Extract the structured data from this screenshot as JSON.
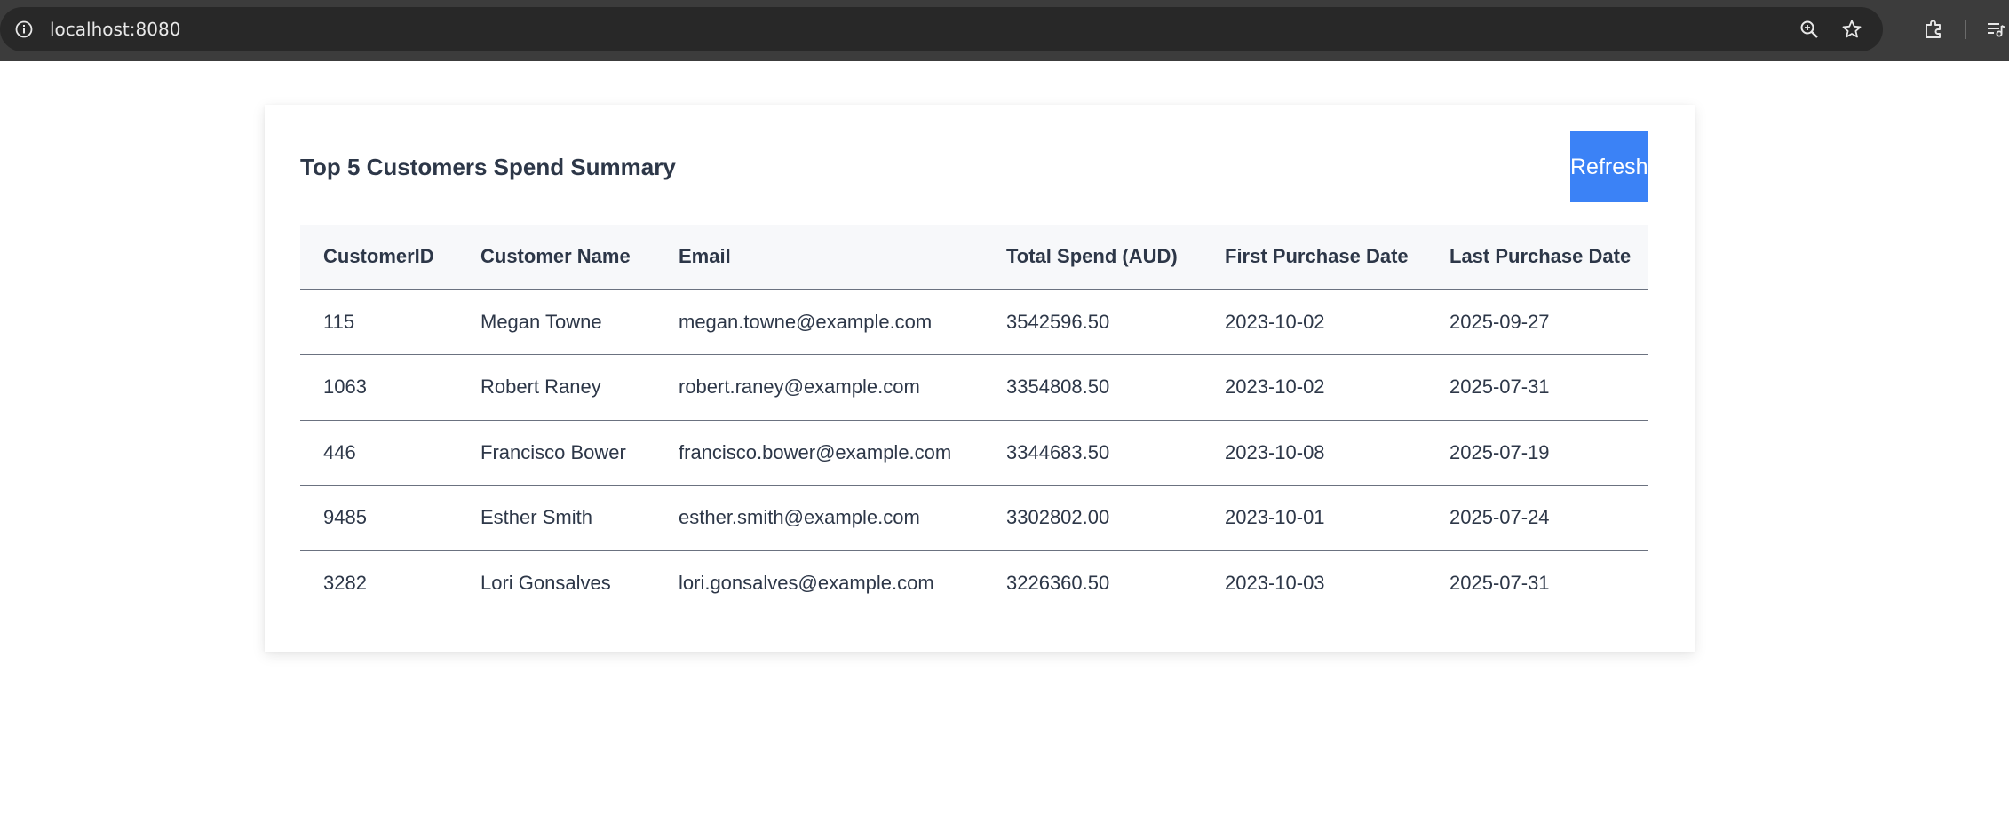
{
  "browser": {
    "url": "localhost:8080",
    "icons": [
      "info-icon",
      "zoom-icon",
      "star-icon",
      "extensions-icon",
      "reading-list-icon"
    ]
  },
  "page": {
    "title": "Top 5 Customers Spend Summary",
    "refresh_label": "Refresh",
    "accent_color": "#3b82f6"
  },
  "table": {
    "columns": [
      "CustomerID",
      "Customer Name",
      "Email",
      "Total Spend (AUD)",
      "First Purchase Date",
      "Last Purchase Date"
    ],
    "rows": [
      [
        "115",
        "Megan Towne",
        "megan.towne@example.com",
        "3542596.50",
        "2023-10-02",
        "2025-09-27"
      ],
      [
        "1063",
        "Robert Raney",
        "robert.raney@example.com",
        "3354808.50",
        "2023-10-02",
        "2025-07-31"
      ],
      [
        "446",
        "Francisco Bower",
        "francisco.bower@example.com",
        "3344683.50",
        "2023-10-08",
        "2025-07-19"
      ],
      [
        "9485",
        "Esther Smith",
        "esther.smith@example.com",
        "3302802.00",
        "2023-10-01",
        "2025-07-24"
      ],
      [
        "3282",
        "Lori Gonsalves",
        "lori.gonsalves@example.com",
        "3226360.50",
        "2023-10-03",
        "2025-07-31"
      ]
    ]
  }
}
